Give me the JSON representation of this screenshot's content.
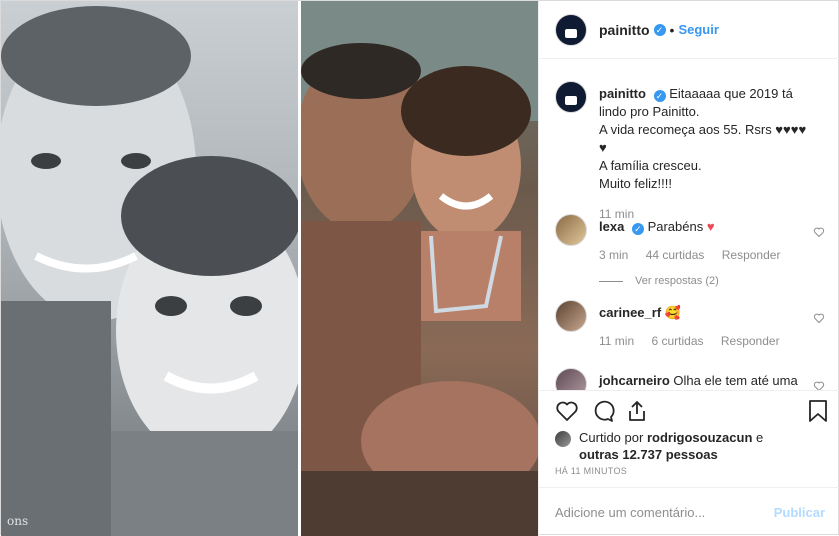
{
  "header": {
    "username": "painitto",
    "separator": "•",
    "follow_label": "Seguir"
  },
  "media": {
    "watermark": "ons"
  },
  "caption": {
    "username": "painitto",
    "text_line1": "Eitaaaaa que 2019 tá lindo pro Painitto.",
    "text_line2": "A vida recomeça aos 55. Rsrs ♥♥♥♥ ♥",
    "text_line3": "A família cresceu.",
    "text_line4": "Muito feliz!!!!",
    "time": "11 min"
  },
  "comments": [
    {
      "username": "lexa",
      "text": "Parabéns",
      "emoji": "♥",
      "time": "3 min",
      "likes": "44 curtidas",
      "reply_label": "Responder",
      "view_replies": "Ver respostas (2)"
    },
    {
      "username": "carinee_rf",
      "text": "",
      "emoji": "🥰",
      "time": "11 min",
      "likes": "6 curtidas",
      "reply_label": "Responder"
    },
    {
      "username": "johcarneiro",
      "text": "Olha ele tem até uma"
    }
  ],
  "likes_summary": {
    "prefix": "Curtido por",
    "user": "rodrigosouzacun",
    "connector": "e",
    "others": "outras 12.737 pessoas"
  },
  "post_time": "HÁ 11 MINUTOS",
  "add_comment": {
    "placeholder": "Adicione um comentário...",
    "publish_label": "Publicar"
  }
}
